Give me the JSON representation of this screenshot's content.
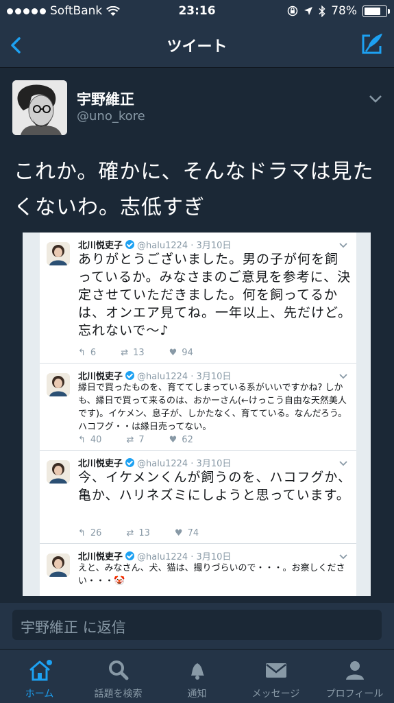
{
  "status_bar": {
    "carrier": "SoftBank",
    "time": "23:16",
    "battery": "78%"
  },
  "nav": {
    "title": "ツイート"
  },
  "tweet": {
    "name": "宇野維正",
    "handle": "@uno_kore",
    "text": "これか。確かに、そんなドラマは見たくないわ。志低すぎ"
  },
  "embedded": [
    {
      "name": "北川悦吏子",
      "handle": "@halu1224 · 3月10日",
      "text": "ありがとうございました。男の子が何を飼っているか。みなさまのご意見を参考に、決定させていただきました。何を飼ってるかは、オンエア見てね。一年以上、先だけど。忘れないで〜♪",
      "replies": "6",
      "retweets": "13",
      "likes": "94"
    },
    {
      "name": "北川悦吏子",
      "handle": "@halu1224 · 3月10日",
      "text": "縁日で買ったものを、育ててしまっている系がいいですかね? しかも、縁日で買って来るのは、おかーさん(←けっこう自由な天然美人です)。イケメン、息子が、しかたなく、育てている。なんだろう。ハコフグ・・は縁日売ってない。",
      "replies": "40",
      "retweets": "7",
      "likes": "62"
    },
    {
      "name": "北川悦吏子",
      "handle": "@halu1224 · 3月10日",
      "text": "今、イケメンくんが飼うのを、ハコフグか、亀か、ハリネズミにしようと思っています。",
      "replies": "26",
      "retweets": "13",
      "likes": "74"
    },
    {
      "name": "北川悦吏子",
      "handle": "@halu1224 · 3月10日",
      "text": "えと、みなさん、犬、猫は、撮りづらいので・・・。お察しください・・・",
      "emoji": "🤡"
    }
  ],
  "reply_placeholder": "宇野維正 に返信",
  "tabs": [
    {
      "label": "ホーム",
      "icon": "home-icon",
      "active": true
    },
    {
      "label": "話題を検索",
      "icon": "search-icon"
    },
    {
      "label": "通知",
      "icon": "bell-icon"
    },
    {
      "label": "メッセージ",
      "icon": "envelope-icon"
    },
    {
      "label": "プロフィール",
      "icon": "person-icon"
    }
  ],
  "colors": {
    "accent": "#1da1f2",
    "background": "#141d26",
    "bar": "#243447",
    "muted": "#8899a6"
  }
}
